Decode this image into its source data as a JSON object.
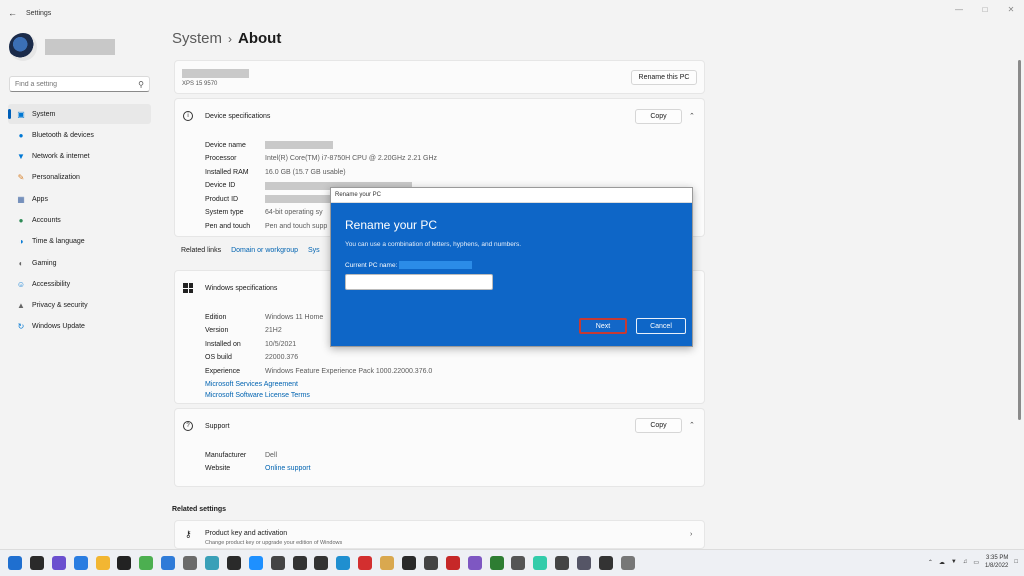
{
  "window": {
    "title": "Settings",
    "back_icon": "arrow-left-icon"
  },
  "sidebar": {
    "search_placeholder": "Find a setting",
    "items": [
      {
        "label": "System",
        "icon": "monitor-icon",
        "color": "#0078d4"
      },
      {
        "label": "Bluetooth & devices",
        "icon": "bluetooth-icon",
        "color": "#0078d4"
      },
      {
        "label": "Network & internet",
        "icon": "wifi-icon",
        "color": "#0078d4"
      },
      {
        "label": "Personalization",
        "icon": "brush-icon",
        "color": "#d9822b"
      },
      {
        "label": "Apps",
        "icon": "apps-icon",
        "color": "#4a6ea8"
      },
      {
        "label": "Accounts",
        "icon": "account-icon",
        "color": "#2e8b57"
      },
      {
        "label": "Time & language",
        "icon": "globe-clock-icon",
        "color": "#0078d4"
      },
      {
        "label": "Gaming",
        "icon": "gamepad-icon",
        "color": "#666666"
      },
      {
        "label": "Accessibility",
        "icon": "accessibility-icon",
        "color": "#0078d4"
      },
      {
        "label": "Privacy & security",
        "icon": "shield-icon",
        "color": "#666666"
      },
      {
        "label": "Windows Update",
        "icon": "update-icon",
        "color": "#0078d4"
      }
    ]
  },
  "header": {
    "crumb": "System",
    "current": "About"
  },
  "pc_card": {
    "model": "XPS 15 9570",
    "rename_label": "Rename this PC"
  },
  "device_specs": {
    "title": "Device specifications",
    "copy_label": "Copy",
    "rows": [
      {
        "label": "Device name",
        "value": ""
      },
      {
        "label": "Processor",
        "value": "Intel(R) Core(TM) i7-8750H CPU @ 2.20GHz   2.21 GHz"
      },
      {
        "label": "Installed RAM",
        "value": "16.0 GB (15.7 GB usable)"
      },
      {
        "label": "Device ID",
        "value": ""
      },
      {
        "label": "Product ID",
        "value": ""
      },
      {
        "label": "System type",
        "value": "64-bit operating sy"
      },
      {
        "label": "Pen and touch",
        "value": "Pen and touch supp"
      }
    ]
  },
  "related_links": {
    "label": "Related links",
    "link1": "Domain or workgroup",
    "link2": "Sys"
  },
  "windows_specs": {
    "title": "Windows specifications",
    "rows": [
      {
        "label": "Edition",
        "value": "Windows 11 Home"
      },
      {
        "label": "Version",
        "value": "21H2"
      },
      {
        "label": "Installed on",
        "value": "10/5/2021"
      },
      {
        "label": "OS build",
        "value": "22000.376"
      },
      {
        "label": "Experience",
        "value": "Windows Feature Experience Pack 1000.22000.376.0"
      }
    ],
    "link1": "Microsoft Services Agreement",
    "link2": "Microsoft Software License Terms"
  },
  "support": {
    "title": "Support",
    "copy_label": "Copy",
    "rows": [
      {
        "label": "Manufacturer",
        "value": "Dell"
      },
      {
        "label": "Website",
        "value": "Online support"
      }
    ]
  },
  "related_settings": {
    "title": "Related settings",
    "item_title": "Product key and activation",
    "item_sub": "Change product key or upgrade your edition of Windows"
  },
  "dialog": {
    "window_title": "Rename your PC",
    "title": "Rename your PC",
    "subtitle": "You can use a combination of letters, hyphens, and numbers.",
    "current_label": "Current PC name:",
    "input_value": "",
    "next_label": "Next",
    "cancel_label": "Cancel"
  },
  "taskbar": {
    "time": "3:35 PM",
    "date": "1/8/2022",
    "icons": [
      "#1f6fd0",
      "#2a2a2a",
      "#6a4fcf",
      "#2a7de1",
      "#f2b632",
      "#222",
      "#4caf50",
      "#2f7bd8",
      "#6a6a6a",
      "#3aa0b8",
      "#2a2a2a",
      "#1e90ff",
      "#444",
      "#333",
      "#333",
      "#1f8fd0",
      "#d32f2f",
      "#d9a84f",
      "#2a2a2a",
      "#444",
      "#c62828",
      "#7e57c2",
      "#2e7d32",
      "#555",
      "#3ca",
      "#444",
      "#556",
      "#333",
      "#555",
      "#777"
    ]
  }
}
